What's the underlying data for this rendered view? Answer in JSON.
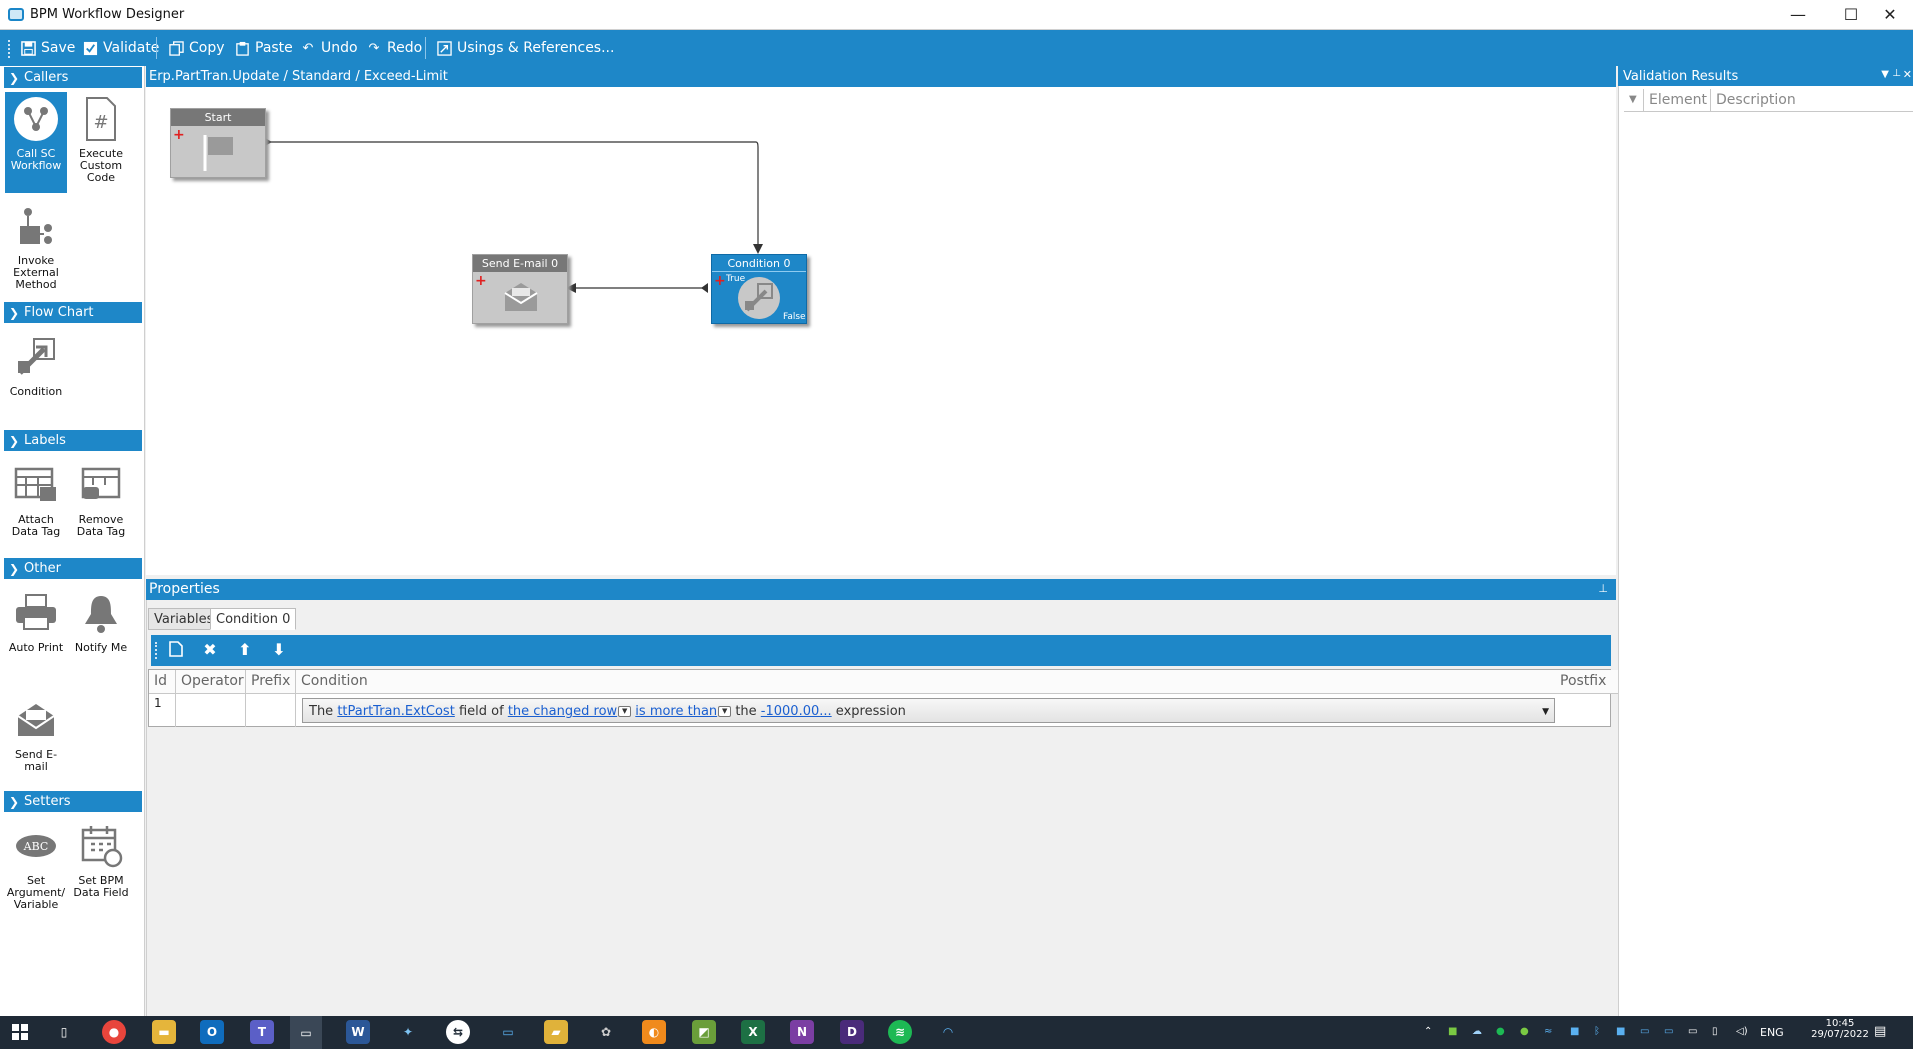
{
  "window": {
    "title": "BPM Workflow Designer",
    "minimize": "—",
    "maximize": "☐",
    "close": "✕"
  },
  "toolbar": {
    "save": "Save",
    "validate": "Validate",
    "copy": "Copy",
    "paste": "Paste",
    "undo": "Undo",
    "redo": "Redo",
    "usings": "Usings & References..."
  },
  "toolbox": {
    "groups": {
      "callers": "Callers",
      "flowchart": "Flow Chart",
      "labels": "Labels",
      "other": "Other",
      "setters": "Setters"
    },
    "tools": {
      "call_sc": "Call SC Workflow",
      "execute_code": "Execute Custom Code",
      "invoke_method": "Invoke External Method",
      "condition": "Condition",
      "attach_tag": "Attach Data Tag",
      "remove_tag": "Remove Data Tag",
      "auto_print": "Auto Print",
      "notify_me": "Notify Me",
      "send_email": "Send E-mail",
      "set_argument": "Set Argument/ Variable",
      "set_bpm_field": "Set BPM Data Field"
    },
    "selected": "call_sc"
  },
  "designer": {
    "breadcrumb": "Erp.PartTran.Update / Standard / Exceed-Limit",
    "nodes": {
      "start": "Start",
      "send_email": "Send E-mail 0",
      "condition": "Condition 0",
      "true_label": "True",
      "false_label": "False"
    }
  },
  "properties": {
    "title": "Properties",
    "tabs": [
      "Variables",
      "Condition 0"
    ],
    "active_tab": "Condition 0",
    "grid": {
      "columns": [
        "Id",
        "Operator",
        "Prefix",
        "Condition",
        "Postfix"
      ],
      "rows": [
        {
          "id": "1",
          "operator": "",
          "prefix": "",
          "postfix": "",
          "condition": {
            "t1": "The",
            "field": "ttPartTran.ExtCost",
            "t2": "field of",
            "row": "the changed row",
            "op": "is more than",
            "t3": "the",
            "value": "-1000.00...",
            "t4": "expression"
          }
        }
      ]
    }
  },
  "validation": {
    "title": "Validation Results",
    "columns": [
      "Element",
      "Description"
    ]
  },
  "taskbar": {
    "language": "ENG",
    "time": "10:45",
    "date": "29/07/2022"
  },
  "colors": {
    "accent": "#1e87c8",
    "taskbar": "#1f2a36",
    "link": "#1a5fd0"
  }
}
